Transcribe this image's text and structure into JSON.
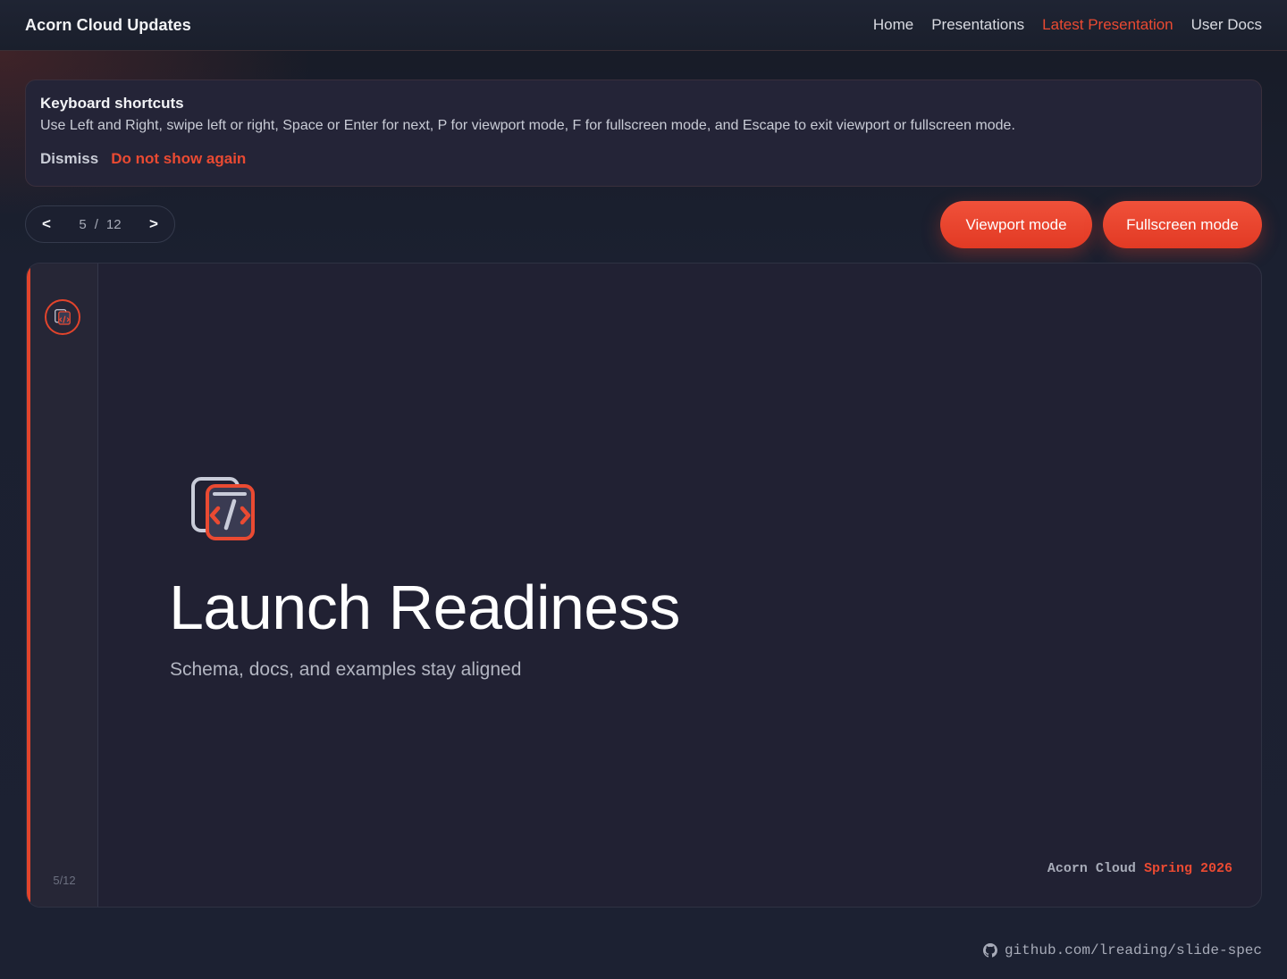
{
  "header": {
    "brand": "Acorn Cloud Updates",
    "nav": [
      "Home",
      "Presentations",
      "Latest Presentation",
      "User Docs"
    ],
    "active_nav": "Latest Presentation"
  },
  "shortcuts": {
    "title": "Keyboard shortcuts",
    "body": "Use Left and Right, swipe left or right, Space or Enter for next, P for viewport mode, F for fullscreen mode, and Escape to exit viewport or fullscreen mode.",
    "dismiss_label": "Dismiss",
    "no_show_label": "Do not show again"
  },
  "pager": {
    "prev": "<",
    "next": ">",
    "current": "5",
    "separator": "/",
    "total": "12"
  },
  "modes": {
    "viewport_label": "Viewport mode",
    "fullscreen_label": "Fullscreen mode"
  },
  "slide": {
    "title": "Launch Readiness",
    "subtitle": "Schema, docs, and examples stay aligned",
    "rail_count": "5/12",
    "footer_org": "Acorn Cloud",
    "footer_season": "Spring 2026"
  },
  "footer": {
    "repo": "github.com/lreading/slide-spec"
  },
  "colors": {
    "accent": "#ea4a32",
    "background": "#1b2030",
    "slide_bg": "#212133"
  },
  "icons": {
    "logo": "code-bracket-logo-icon",
    "github": "github-icon"
  }
}
